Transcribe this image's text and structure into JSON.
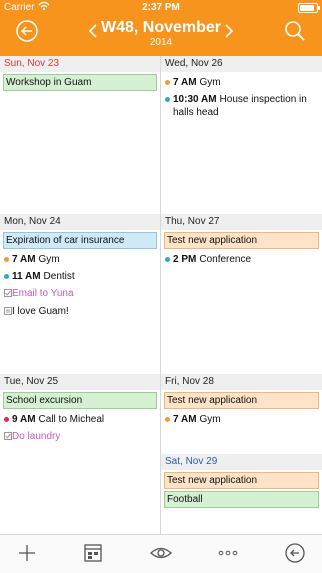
{
  "status_bar": {
    "carrier": "Carrier",
    "time": "2:37 PM"
  },
  "header": {
    "week_title": "W48, November",
    "year": "2014"
  },
  "colors": {
    "accent": "#f7941d",
    "sunday": "#e0382f",
    "saturday": "#2d5ba8"
  },
  "days": {
    "sun": {
      "label": "Sun, Nov 23",
      "allday": [
        {
          "text": "Workshop in Guam"
        }
      ]
    },
    "mon": {
      "label": "Mon, Nov 24",
      "allday": [
        {
          "text": "Expiration of car insurance"
        }
      ],
      "items": [
        {
          "time": "7 AM",
          "text": "Gym"
        },
        {
          "time": "11 AM",
          "text": "Dentist"
        },
        {
          "text": "Email to Yuna"
        },
        {
          "text": "I love Guam!"
        }
      ]
    },
    "tue": {
      "label": "Tue, Nov 25",
      "allday": [
        {
          "text": "School excursion"
        }
      ],
      "items": [
        {
          "time": "9 AM",
          "text": "Call to Micheal"
        },
        {
          "text": "Do laundry"
        }
      ]
    },
    "wed": {
      "label": "Wed, Nov 26",
      "items": [
        {
          "time": "7 AM",
          "text": "Gym"
        },
        {
          "time": "10:30 AM",
          "text": "House inspection in halls head"
        }
      ]
    },
    "thu": {
      "label": "Thu, Nov 27",
      "allday": [
        {
          "text": "Test new application"
        }
      ],
      "items": [
        {
          "time": "2 PM",
          "text": "Conference"
        }
      ]
    },
    "fri": {
      "label": "Fri, Nov 28",
      "allday": [
        {
          "text": "Test new application"
        }
      ],
      "items": [
        {
          "time": "7 AM",
          "text": "Gym"
        }
      ]
    },
    "sat": {
      "label": "Sat, Nov 29",
      "allday": [
        {
          "text": "Test new application"
        },
        {
          "text": "Football"
        }
      ]
    }
  },
  "toolbar": {
    "icons": [
      "add-icon",
      "calendar-view-icon",
      "eye-icon",
      "more-icon",
      "today-icon"
    ]
  }
}
